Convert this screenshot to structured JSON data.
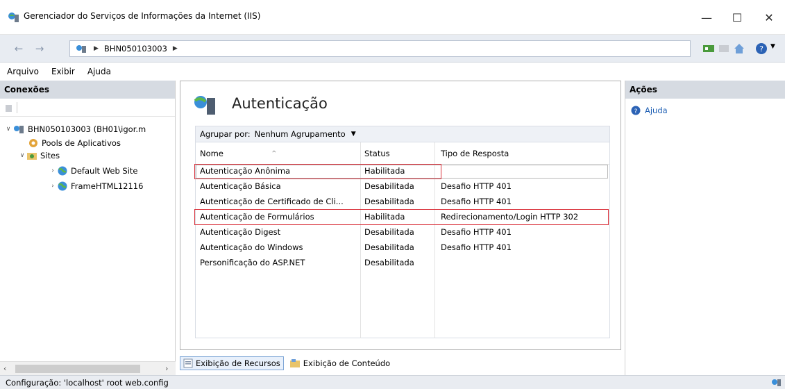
{
  "window": {
    "title": "Gerenciador do Serviços de Informações da Internet (IIS)",
    "minimize_label": "—",
    "maximize_label": "☐",
    "close_label": "✕"
  },
  "address": {
    "back_glyph": "←",
    "forward_glyph": "→",
    "path": [
      "BHN050103003"
    ]
  },
  "menu": [
    "Arquivo",
    "Exibir",
    "Ajuda"
  ],
  "connections": {
    "header": "Conexões",
    "tree": {
      "server": "BHN050103003 (BH01\\igor.m",
      "app_pools": "Pools de Aplicativos",
      "sites": "Sites",
      "site_1": "Default Web Site",
      "site_2": "FrameHTML12116"
    }
  },
  "main": {
    "title": "Autenticação",
    "group_by_label": "Agrupar por:",
    "group_by_value": "Nenhum Agrupamento",
    "columns": [
      "Nome",
      "Status",
      "Tipo de Resposta"
    ],
    "rows": [
      {
        "name": "Autenticação Anônima",
        "status": "Habilitada",
        "response": ""
      },
      {
        "name": "Autenticação Básica",
        "status": "Desabilitada",
        "response": "Desafio HTTP 401"
      },
      {
        "name": "Autenticação de Certificado de Cli...",
        "status": "Desabilitada",
        "response": "Desafio HTTP 401"
      },
      {
        "name": "Autenticação de Formulários",
        "status": "Habilitada",
        "response": "Redirecionamento/Login HTTP 302"
      },
      {
        "name": "Autenticação Digest",
        "status": "Desabilitada",
        "response": "Desafio HTTP 401"
      },
      {
        "name": "Autenticação do Windows",
        "status": "Desabilitada",
        "response": "Desafio HTTP 401"
      },
      {
        "name": "Personificação do ASP.NET",
        "status": "Desabilitada",
        "response": ""
      }
    ],
    "view_tabs": [
      "Exibição de Recursos",
      "Exibição de Conteúdo"
    ]
  },
  "actions": {
    "header": "Ações",
    "items": [
      "Ajuda"
    ]
  },
  "status": {
    "text": "Configuração: 'localhost' root web.config"
  },
  "colors": {
    "highlight": "#d9303a",
    "panel_header": "#d6dbe2",
    "link": "#1e5fb4"
  }
}
